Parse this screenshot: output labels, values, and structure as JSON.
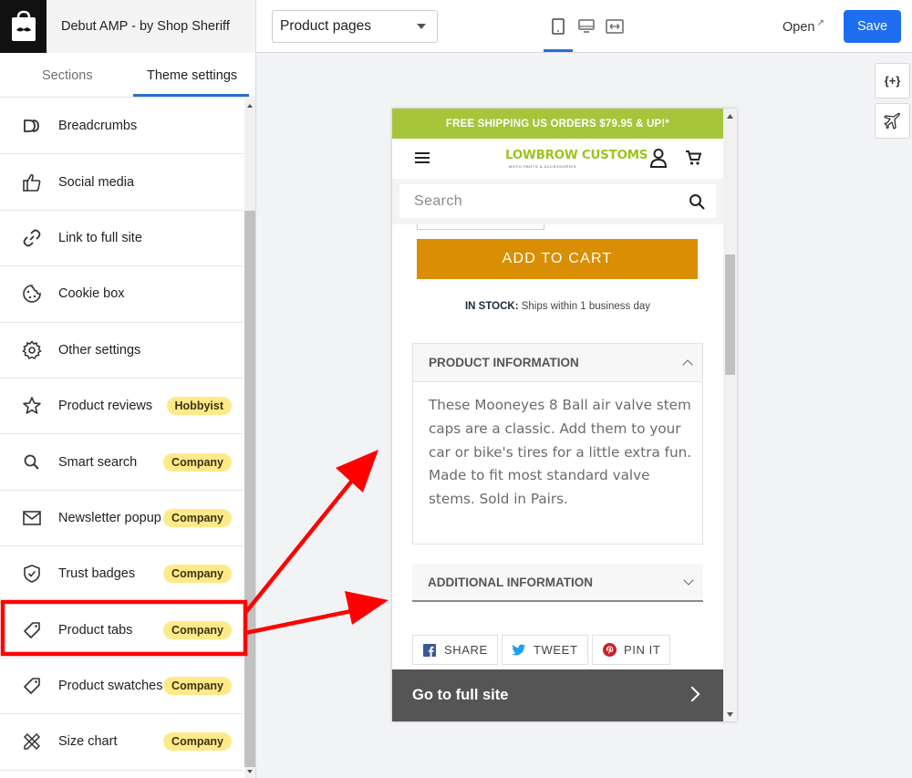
{
  "app": {
    "title": "Debut AMP - by Shop Sheriff"
  },
  "toolbar": {
    "page_select": "Product pages",
    "open_label": "Open",
    "save_label": "Save"
  },
  "sidebar": {
    "tabs": [
      "Sections",
      "Theme settings"
    ],
    "items": [
      {
        "label": "Breadcrumbs",
        "icon": "breadcrumbs-icon",
        "badge": ""
      },
      {
        "label": "Social media",
        "icon": "thumbs-up-icon",
        "badge": ""
      },
      {
        "label": "Link to full site",
        "icon": "link-icon",
        "badge": ""
      },
      {
        "label": "Cookie box",
        "icon": "cookie-icon",
        "badge": ""
      },
      {
        "label": "Other settings",
        "icon": "gear-icon",
        "badge": ""
      },
      {
        "label": "Product reviews",
        "icon": "star-icon",
        "badge": "Hobbyist"
      },
      {
        "label": "Smart search",
        "icon": "search-icon",
        "badge": "Company"
      },
      {
        "label": "Newsletter popup",
        "icon": "envelope-icon",
        "badge": "Company"
      },
      {
        "label": "Trust badges",
        "icon": "shield-icon",
        "badge": "Company"
      },
      {
        "label": "Product tabs",
        "icon": "tag-icon",
        "badge": "Company"
      },
      {
        "label": "Product swatches",
        "icon": "tag-icon",
        "badge": "Company"
      },
      {
        "label": "Size chart",
        "icon": "ruler-pencil-icon",
        "badge": "Company"
      }
    ]
  },
  "tools": {
    "code_label": "{+}"
  },
  "preview": {
    "shipping_banner": "FREE SHIPPING US ORDERS $79.95 & UP!*",
    "brand": "LOWBROW CUSTOMS",
    "brand_sub": "MOTO PARTS & ACCESSORIES",
    "search_placeholder": "Search",
    "add_to_cart": "ADD TO CART",
    "stock_label": "IN STOCK:",
    "stock_text": " Ships within 1 business day",
    "product_info_title": "PRODUCT INFORMATION",
    "product_info_body": "These Mooneyes 8 Ball air valve stem caps are a classic. Add them to your car or bike's tires for a little extra fun. Made to fit most standard valve stems. Sold in Pairs.",
    "additional_info_title": "ADDITIONAL INFORMATION",
    "share": "SHARE",
    "tweet": "TWEET",
    "pin": "PIN IT",
    "full_site": "Go to full site"
  },
  "colors": {
    "accent": "#1e6ef2",
    "badge": "#ffea8a",
    "shipping_bar": "#a6c53a",
    "add_to_cart": "#d98e04",
    "annotation": "#ff0000"
  }
}
